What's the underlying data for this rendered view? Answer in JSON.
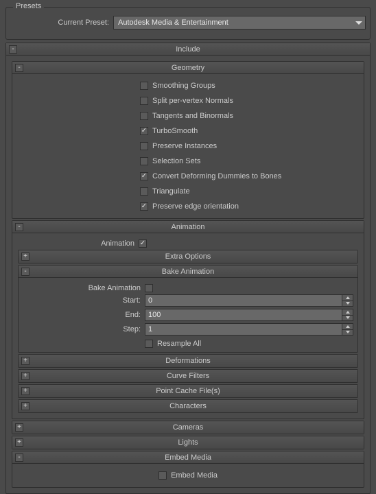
{
  "presets": {
    "group_label": "Presets",
    "current_preset_label": "Current Preset:",
    "current_preset_value": "Autodesk Media & Entertainment"
  },
  "include": {
    "title": "Include",
    "toggle": "-",
    "geometry": {
      "title": "Geometry",
      "toggle": "-",
      "options": [
        {
          "label": "Smoothing Groups",
          "checked": false
        },
        {
          "label": "Split per-vertex Normals",
          "checked": false
        },
        {
          "label": "Tangents and Binormals",
          "checked": false
        },
        {
          "label": "TurboSmooth",
          "checked": true
        },
        {
          "label": "Preserve Instances",
          "checked": false
        },
        {
          "label": "Selection Sets",
          "checked": false
        },
        {
          "label": "Convert Deforming Dummies to Bones",
          "checked": true
        },
        {
          "label": "Triangulate",
          "checked": false
        },
        {
          "label": "Preserve edge orientation",
          "checked": true
        }
      ]
    },
    "animation": {
      "title": "Animation",
      "toggle": "-",
      "animation_label": "Animation",
      "animation_checked": true,
      "extra_options": {
        "title": "Extra Options",
        "toggle": "+"
      },
      "bake_animation": {
        "title": "Bake Animation",
        "toggle": "-",
        "bake_label": "Bake Animation",
        "bake_checked": false,
        "start_label": "Start:",
        "start_value": "0",
        "end_label": "End:",
        "end_value": "100",
        "step_label": "Step:",
        "step_value": "1",
        "resample_label": "Resample All",
        "resample_checked": false
      },
      "deformations": {
        "title": "Deformations",
        "toggle": "+"
      },
      "curve_filters": {
        "title": "Curve Filters",
        "toggle": "+"
      },
      "point_cache": {
        "title": "Point Cache File(s)",
        "toggle": "+"
      },
      "characters": {
        "title": "Characters",
        "toggle": "+"
      }
    },
    "cameras": {
      "title": "Cameras",
      "toggle": "+"
    },
    "lights": {
      "title": "Lights",
      "toggle": "+"
    },
    "embed_media": {
      "title": "Embed Media",
      "toggle": "-",
      "label": "Embed Media",
      "checked": false
    }
  }
}
